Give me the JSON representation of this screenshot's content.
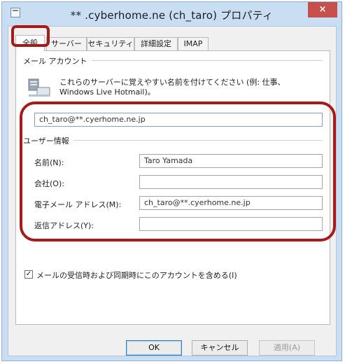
{
  "window": {
    "title": "** .cyberhome.ne (ch_taro) プロパティ",
    "close_label": "×"
  },
  "tabs": [
    "全般",
    "サーバー",
    "セキュリティ",
    "詳細設定",
    "IMAP"
  ],
  "account_group": {
    "label": "メール アカウント",
    "info_line1": "これらのサーバーに覚えやすい名前を付けてください (例: 仕事、",
    "info_line2": "Windows Live Hotmail)。",
    "account_name": "ch_taro@**.cyerhome.ne.jp"
  },
  "user_group": {
    "label": "ユーザー情報",
    "fields": [
      {
        "label": "名前(N):",
        "value": "Taro Yamada"
      },
      {
        "label": "会社(O):",
        "value": ""
      },
      {
        "label": "電子メール アドレス(M):",
        "value": "ch_taro@**.cyerhome.ne.jp"
      },
      {
        "label": "返信アドレス(Y):",
        "value": ""
      }
    ]
  },
  "include_checkbox": {
    "label": "メールの受信時および同期時にこのアカウントを含める(I)",
    "checked": true
  },
  "buttons": {
    "ok": "OK",
    "cancel": "キャンセル",
    "apply": "適用(A)"
  },
  "colors": {
    "highlight": "#a81a1a",
    "titlebar": "#c9ddf3",
    "close": "#c7504c"
  }
}
